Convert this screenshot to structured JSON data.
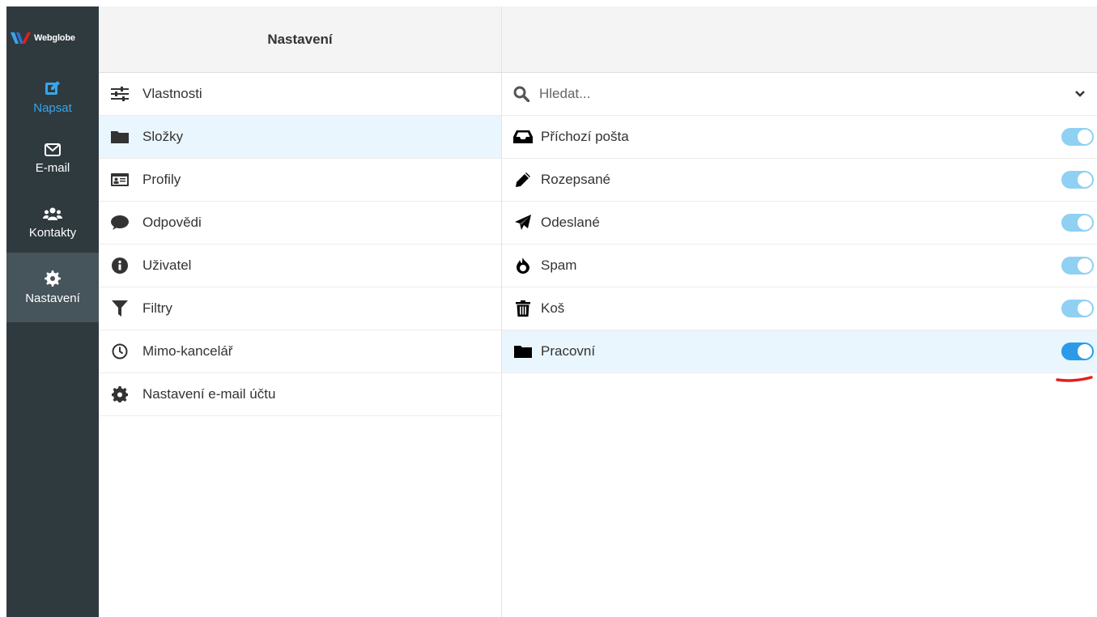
{
  "brand": {
    "name": "Webglobe"
  },
  "sidebar": {
    "items": [
      {
        "key": "compose",
        "label": "Napsat",
        "icon": "edit-icon"
      },
      {
        "key": "email",
        "label": "E-mail",
        "icon": "envelope-icon"
      },
      {
        "key": "contacts",
        "label": "Kontakty",
        "icon": "users-icon"
      },
      {
        "key": "settings",
        "label": "Nastavení",
        "icon": "gear-icon"
      }
    ]
  },
  "settings_menu": {
    "title": "Nastavení",
    "items": [
      {
        "label": "Vlastnosti",
        "icon": "sliders-icon"
      },
      {
        "label": "Složky",
        "icon": "folder-icon"
      },
      {
        "label": "Profily",
        "icon": "id-card-icon"
      },
      {
        "label": "Odpovědi",
        "icon": "comment-icon"
      },
      {
        "label": "Uživatel",
        "icon": "info-icon"
      },
      {
        "label": "Filtry",
        "icon": "filter-icon"
      },
      {
        "label": "Mimo-kancelář",
        "icon": "clock-icon"
      },
      {
        "label": "Nastavení e-mail účtu",
        "icon": "gear-icon"
      }
    ]
  },
  "folders": {
    "search": {
      "placeholder": "Hledat..."
    },
    "items": [
      {
        "label": "Příchozí pošta",
        "icon": "inbox-icon",
        "subscribed": true
      },
      {
        "label": "Rozepsané",
        "icon": "pencil-icon",
        "subscribed": true
      },
      {
        "label": "Odeslané",
        "icon": "paper-plane-icon",
        "subscribed": true
      },
      {
        "label": "Spam",
        "icon": "fire-icon",
        "subscribed": true
      },
      {
        "label": "Koš",
        "icon": "trash-icon",
        "subscribed": true
      },
      {
        "label": "Pracovní",
        "icon": "folder-icon",
        "subscribed": true
      }
    ]
  },
  "colors": {
    "sidebar_bg": "#2f3a3f",
    "sidebar_active": "#46545b",
    "accent": "#37a6e8",
    "selected_row": "#e9f6fd",
    "toggle_on": "#8fd0f3",
    "toggle_strong": "#2b9ae8",
    "annotation": "#e0201c"
  }
}
